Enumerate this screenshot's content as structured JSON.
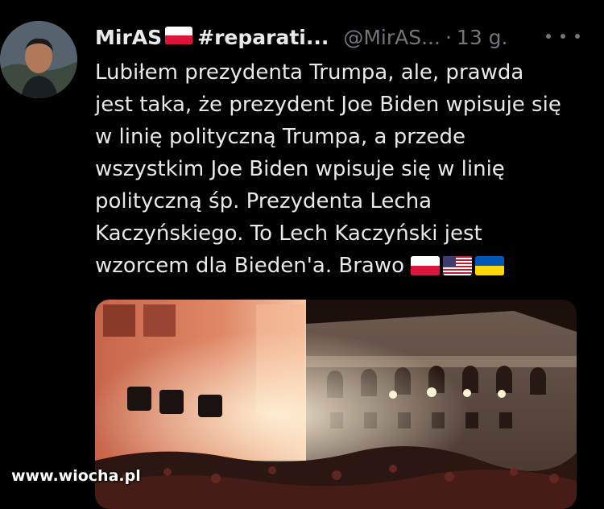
{
  "tweet": {
    "author_name": "MirAS",
    "hashtag": "#reparati...",
    "handle": "@MirAS...",
    "separator": "·",
    "time": "13 g.",
    "text_lines": [
      "Lubiłem prezydenta Trumpa, ale, prawda",
      "jest taka, że prezydent Joe Biden wpisuje się",
      "w linię polityczną Trumpa, a przede",
      "wszystkim Joe Biden wpisuje się w linię",
      "polityczną śp. Prezydenta Lecha",
      "Kaczyńskiego. To Lech Kaczyński jest",
      "wzorcem dla Bieden'a. Brawo"
    ],
    "flags": [
      "poland-flag-icon",
      "usa-flag-icon",
      "ukraine-flag-icon"
    ]
  },
  "watermark": "www.wiocha.pl",
  "colors": {
    "background": "#000000",
    "text_primary": "#e7e9ea",
    "text_secondary": "#71767b"
  }
}
